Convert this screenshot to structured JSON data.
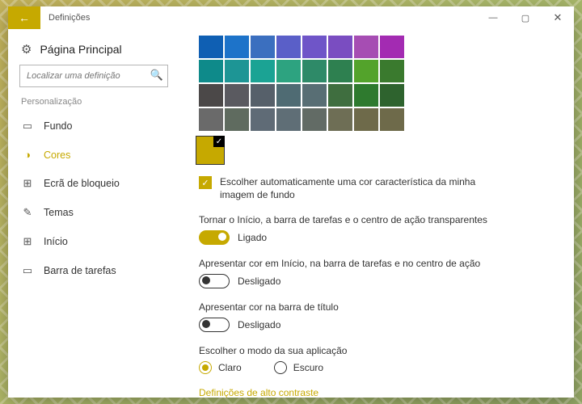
{
  "title": "Definições",
  "search": {
    "placeholder": "Localizar uma definição"
  },
  "home": "Página Principal",
  "section": "Personalização",
  "nav": [
    {
      "icon": "▭",
      "label": "Fundo",
      "name": "nav-background"
    },
    {
      "icon": "◑",
      "label": "Cores",
      "name": "nav-colors",
      "active": true
    },
    {
      "icon": "⊞",
      "label": "Ecrã de bloqueio",
      "name": "nav-lockscreen"
    },
    {
      "icon": "✎",
      "label": "Temas",
      "name": "nav-themes"
    },
    {
      "icon": "⊞",
      "label": "Início",
      "name": "nav-start"
    },
    {
      "icon": "▭",
      "label": "Barra de tarefas",
      "name": "nav-taskbar"
    }
  ],
  "swatches": [
    [
      "#0f5fb3",
      "#1d73c9",
      "#3b6fbf",
      "#5a5fc8",
      "#6f55c8",
      "#7a4dc1",
      "#a64db3",
      "#a32bb2"
    ],
    [
      "#0e8a8a",
      "#1d9595",
      "#1ba394",
      "#2da380",
      "#2e8a68",
      "#2e8050",
      "#53a32b",
      "#3a7a2e"
    ],
    [
      "#4b4848",
      "#5a5a60",
      "#56606a",
      "#4f6b73",
      "#586e74",
      "#3f6e3f",
      "#2e7a2e",
      "#2e632e"
    ],
    [
      "#6a6a6a",
      "#5f6b5f",
      "#5f6b76",
      "#5f6e76",
      "#626b65",
      "#6e6e55",
      "#6e6a4a",
      "#6e6a4a"
    ]
  ],
  "selected_color": "#c6a900",
  "auto_label": "Escolher automaticamente uma cor característica da minha imagem de fundo",
  "groups": {
    "transparent": {
      "label": "Tornar o Início, a barra de tarefas e o centro de ação transparentes",
      "on": true,
      "text": "Ligado"
    },
    "show_color_start": {
      "label": "Apresentar cor em Início, na barra de tarefas e no centro de ação",
      "on": false,
      "text": "Desligado"
    },
    "show_color_title": {
      "label": "Apresentar cor na barra de título",
      "on": false,
      "text": "Desligado"
    },
    "app_mode": {
      "label": "Escolher o modo da sua aplicação",
      "options": {
        "light": "Claro",
        "dark": "Escuro"
      },
      "selected": "light"
    }
  },
  "high_contrast": "Definições de alto contraste"
}
